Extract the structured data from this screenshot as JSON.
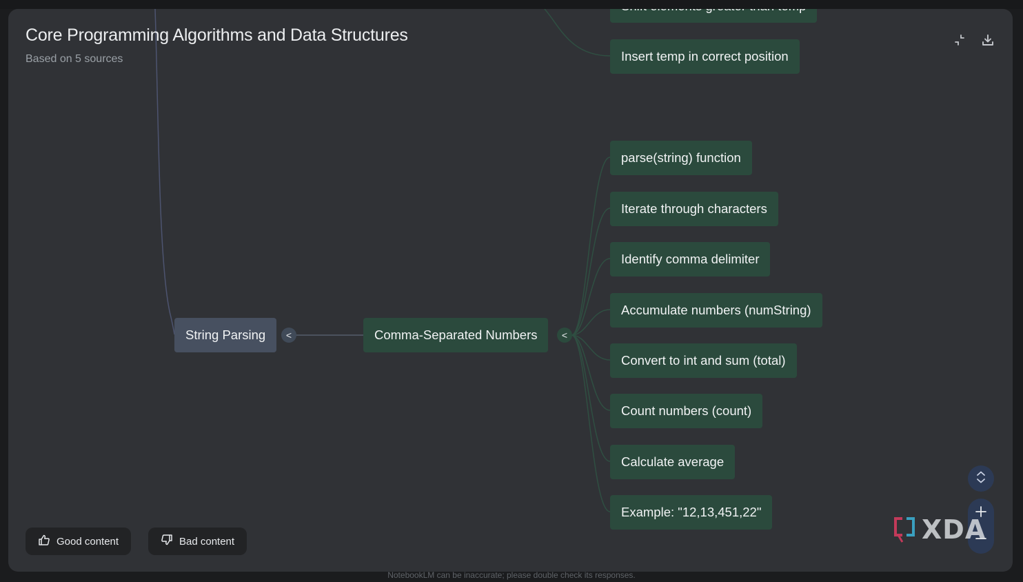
{
  "header": {
    "title": "Core Programming Algorithms and Data Structures",
    "subtitle": "Based on 5 sources"
  },
  "mindmap": {
    "partial_top_node": "Shift elements greater than temp",
    "top_node": "Insert temp in correct position",
    "root": {
      "label": "String Parsing",
      "toggle": "<"
    },
    "branch": {
      "label": "Comma-Separated Numbers",
      "toggle": "<"
    },
    "leaves": [
      "parse(string) function",
      "Iterate through characters",
      "Identify comma delimiter",
      "Accumulate numbers (numString)",
      "Convert to int and sum (total)",
      "Count numbers (count)",
      "Calculate average",
      "Example: \"12,13,451,22\""
    ]
  },
  "feedback": {
    "good_label": "Good content",
    "bad_label": "Bad content"
  },
  "controls": {
    "collapse_icon": "collapse-icon",
    "download_icon": "download-icon",
    "expand_icon": "unfold-icon",
    "zoom_in_icon": "plus-icon",
    "zoom_out_icon": "minus-icon"
  },
  "watermark": "XDA",
  "disclaimer": "NotebookLM can be inaccurate; please double check its responses.",
  "colors": {
    "panel_bg": "#303236",
    "leaf_node": "#2b4a3d",
    "root_node": "#475060",
    "control_bg": "#2c3a55"
  }
}
